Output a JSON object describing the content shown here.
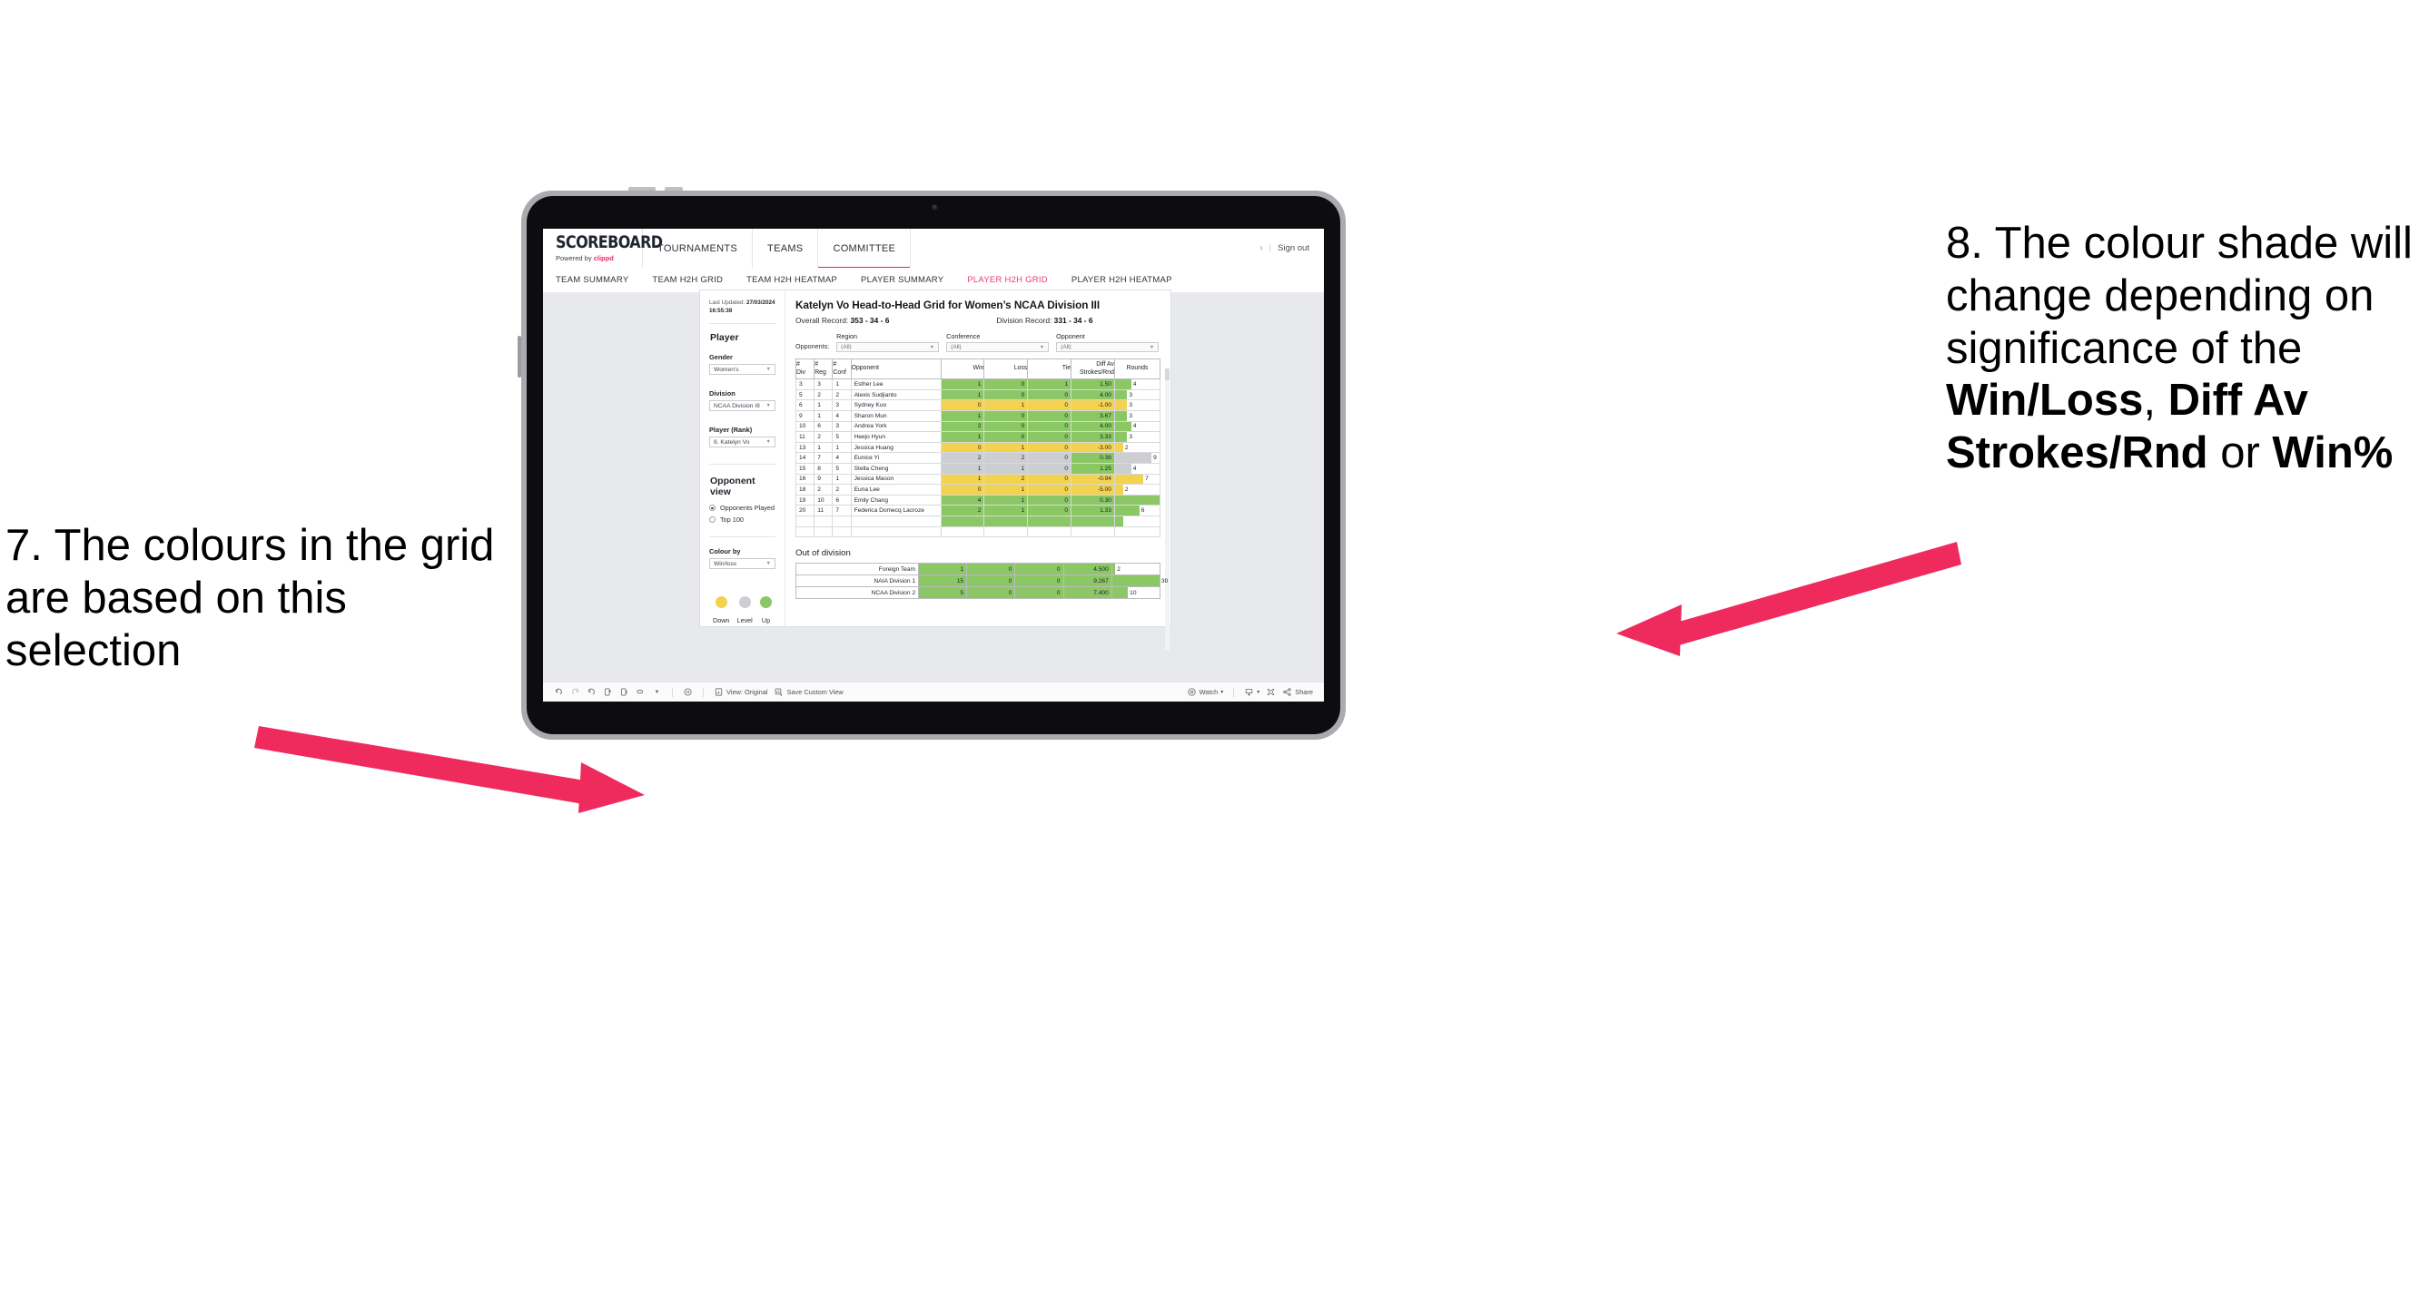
{
  "annotations": {
    "left": {
      "text": "7. The colours in the grid are based on this selection",
      "arrow_color": "#EF2B5E"
    },
    "right": {
      "prefix": "8. The colour shade will change depending on significance of the ",
      "bold1": "Win/Loss",
      "mid1": ", ",
      "bold2": "Diff Av Strokes/Rnd",
      "mid2": " or ",
      "bold3": "Win%",
      "arrow_color": "#EF2B5E"
    }
  },
  "app": {
    "logo": {
      "main": "SCOREBOARD",
      "powered_prefix": "Powered by ",
      "brand": "clippd"
    },
    "nav": [
      {
        "label": "TOURNAMENTS",
        "active": false
      },
      {
        "label": "TEAMS",
        "active": false
      },
      {
        "label": "COMMITTEE",
        "active": true
      }
    ],
    "account": {
      "chevron": "›",
      "divider": "|",
      "sign_out": "Sign out"
    },
    "subnav": [
      {
        "label": "TEAM SUMMARY",
        "active": false
      },
      {
        "label": "TEAM H2H GRID",
        "active": false
      },
      {
        "label": "TEAM H2H HEATMAP",
        "active": false
      },
      {
        "label": "PLAYER SUMMARY",
        "active": false
      },
      {
        "label": "PLAYER H2H GRID",
        "active": true
      },
      {
        "label": "PLAYER H2H HEATMAP",
        "active": false
      }
    ],
    "accent_active": "#EF3A68",
    "accent_brand": "#EB2E63"
  },
  "sidebar": {
    "last_updated_label": "Last Updated: ",
    "last_updated_date": "27/03/2024",
    "last_updated_time": "16:55:38",
    "player_heading": "Player",
    "fields": [
      {
        "label": "Gender",
        "value": "Women’s"
      },
      {
        "label": "Division",
        "value": "NCAA Division III"
      },
      {
        "label": "Player (Rank)",
        "value": "8. Katelyn Vo"
      }
    ],
    "opponent_view": {
      "heading": "Opponent view",
      "options": [
        {
          "label": "Opponents Played",
          "selected": true
        },
        {
          "label": "Top 100",
          "selected": false
        }
      ]
    },
    "colour_by": {
      "label": "Colour by",
      "value": "Win/loss"
    },
    "legend": [
      {
        "label": "Down",
        "color": "#F3D34E"
      },
      {
        "label": "Level",
        "color": "#CDCED2"
      },
      {
        "label": "Up",
        "color": "#8CC765"
      }
    ]
  },
  "main": {
    "title": "Katelyn Vo Head-to-Head Grid for Women’s NCAA Division III",
    "overall_record_label": "Overall Record: ",
    "overall_record_value": "353 -  34 - 6",
    "division_record_label": "Division Record: ",
    "division_record_value": "331 -  34 - 6",
    "opponents_label": "Opponents:",
    "filters": [
      {
        "label": "Region",
        "value": "(All)"
      },
      {
        "label": "Conference",
        "value": "(All)"
      },
      {
        "label": "Opponent",
        "value": "(All)"
      }
    ],
    "columns": [
      "# Div",
      "# Reg",
      "# Conf",
      "Opponent",
      "Win",
      "Loss",
      "Tie",
      "Diff Av Strokes/Rnd",
      "Rounds"
    ],
    "column_head_lines": {
      "div": [
        "#",
        "Div"
      ],
      "reg": [
        "#",
        "Reg"
      ],
      "conf": [
        "#",
        "Conf"
      ],
      "opp": [
        "Opponent"
      ],
      "win": [
        "Win"
      ],
      "loss": [
        "Loss"
      ],
      "tie": [
        "Tie"
      ],
      "diff": [
        "Diff Av",
        "Strokes/Rnd"
      ],
      "rounds": [
        "Rounds"
      ]
    },
    "out_of_division_title": "Out of division"
  },
  "chart_data": {
    "type": "table",
    "title": "Katelyn Vo Head-to-Head Grid for Women’s NCAA Division III",
    "columns": [
      "# Div",
      "# Reg",
      "# Conf",
      "Opponent",
      "Win",
      "Loss",
      "Tie",
      "Diff Av Strokes/Rnd",
      "Rounds"
    ],
    "colour_by": "Win/loss",
    "colour_scale": {
      "up": "#8CC765",
      "level": "#CDCED2",
      "down": "#F3D34E"
    },
    "rounds_bar_max": 11,
    "rows": [
      {
        "div": "3",
        "reg": "3",
        "conf": "1",
        "opponent": "Esther Lee",
        "win": "1",
        "loss": "0",
        "tie": "1",
        "diff": "1.50",
        "rounds": 4,
        "state": "up"
      },
      {
        "div": "5",
        "reg": "2",
        "conf": "2",
        "opponent": "Alexis Sudjianto",
        "win": "1",
        "loss": "0",
        "tie": "0",
        "diff": "4.00",
        "rounds": 3,
        "state": "up"
      },
      {
        "div": "6",
        "reg": "1",
        "conf": "3",
        "opponent": "Sydney Kuo",
        "win": "0",
        "loss": "1",
        "tie": "0",
        "diff": "-1.00",
        "rounds": 3,
        "state": "down"
      },
      {
        "div": "9",
        "reg": "1",
        "conf": "4",
        "opponent": "Sharon Mun",
        "win": "1",
        "loss": "0",
        "tie": "0",
        "diff": "3.67",
        "rounds": 3,
        "state": "up"
      },
      {
        "div": "10",
        "reg": "6",
        "conf": "3",
        "opponent": "Andrea York",
        "win": "2",
        "loss": "0",
        "tie": "0",
        "diff": "4.00",
        "rounds": 4,
        "state": "up"
      },
      {
        "div": "11",
        "reg": "2",
        "conf": "5",
        "opponent": "Heejo Hyun",
        "win": "1",
        "loss": "0",
        "tie": "0",
        "diff": "3.33",
        "rounds": 3,
        "state": "up"
      },
      {
        "div": "13",
        "reg": "1",
        "conf": "1",
        "opponent": "Jessica Huang",
        "win": "0",
        "loss": "1",
        "tie": "0",
        "diff": "-3.00",
        "rounds": 2,
        "state": "down"
      },
      {
        "div": "14",
        "reg": "7",
        "conf": "4",
        "opponent": "Eunice Yi",
        "win": "2",
        "loss": "2",
        "tie": "0",
        "diff": "0.38",
        "rounds": 9,
        "state": "level",
        "diff_state": "up"
      },
      {
        "div": "15",
        "reg": "8",
        "conf": "5",
        "opponent": "Stella Cheng",
        "win": "1",
        "loss": "1",
        "tie": "0",
        "diff": "1.25",
        "rounds": 4,
        "state": "level",
        "diff_state": "up"
      },
      {
        "div": "16",
        "reg": "9",
        "conf": "1",
        "opponent": "Jessica Mason",
        "win": "1",
        "loss": "2",
        "tie": "0",
        "diff": "-0.94",
        "rounds": 7,
        "state": "down"
      },
      {
        "div": "18",
        "reg": "2",
        "conf": "2",
        "opponent": "Euna Lee",
        "win": "0",
        "loss": "1",
        "tie": "0",
        "diff": "-5.00",
        "rounds": 2,
        "state": "down"
      },
      {
        "div": "19",
        "reg": "10",
        "conf": "6",
        "opponent": "Emily Chang",
        "win": "4",
        "loss": "1",
        "tie": "0",
        "diff": "0.30",
        "rounds": 11,
        "state": "up"
      },
      {
        "div": "20",
        "reg": "11",
        "conf": "7",
        "opponent": "Federica Domecq Lacroze",
        "win": "2",
        "loss": "1",
        "tie": "0",
        "diff": "1.33",
        "rounds": 6,
        "state": "up"
      }
    ],
    "out_of_division": {
      "title": "Out of division",
      "rounds_bar_max": 30,
      "rows": [
        {
          "label": "Foreign Team",
          "win": "1",
          "loss": "0",
          "tie": "0",
          "diff": "4.500",
          "rounds": 2,
          "state": "up"
        },
        {
          "label": "NAIA Division 1",
          "win": "15",
          "loss": "0",
          "tie": "0",
          "diff": "9.267",
          "rounds": 30,
          "state": "up"
        },
        {
          "label": "NCAA Division 2",
          "win": "5",
          "loss": "0",
          "tie": "0",
          "diff": "7.400",
          "rounds": 10,
          "state": "up"
        }
      ]
    }
  },
  "toolbar": {
    "view_label": "View: Original",
    "save_label": "Save Custom View",
    "watch_label": "Watch",
    "share_label": "Share",
    "caret": "▾"
  }
}
